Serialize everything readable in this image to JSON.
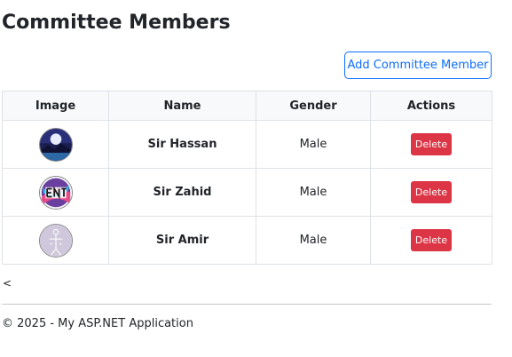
{
  "page": {
    "title": "Committee Members",
    "add_button_label": "Add Committee Member"
  },
  "table": {
    "headers": [
      "Image",
      "Name",
      "Gender",
      "Actions"
    ],
    "rows": [
      {
        "avatar": "night-landscape-avatar",
        "name": "Sir Hassan",
        "gender": "Male",
        "action_label": "Delete"
      },
      {
        "avatar": "colorful-ent-logo-avatar",
        "name": "Sir Zahid",
        "gender": "Male",
        "action_label": "Delete"
      },
      {
        "avatar": "sketch-figure-avatar",
        "name": "Sir Amir",
        "gender": "Male",
        "action_label": "Delete"
      }
    ]
  },
  "nav": {
    "back_link": "<"
  },
  "footer": {
    "text": "© 2025 - My ASP.NET Application"
  },
  "colors": {
    "primary": "#0d6efd",
    "danger": "#dc3545",
    "table_border": "#dee2e6",
    "table_header_bg": "#f8f9fa"
  }
}
